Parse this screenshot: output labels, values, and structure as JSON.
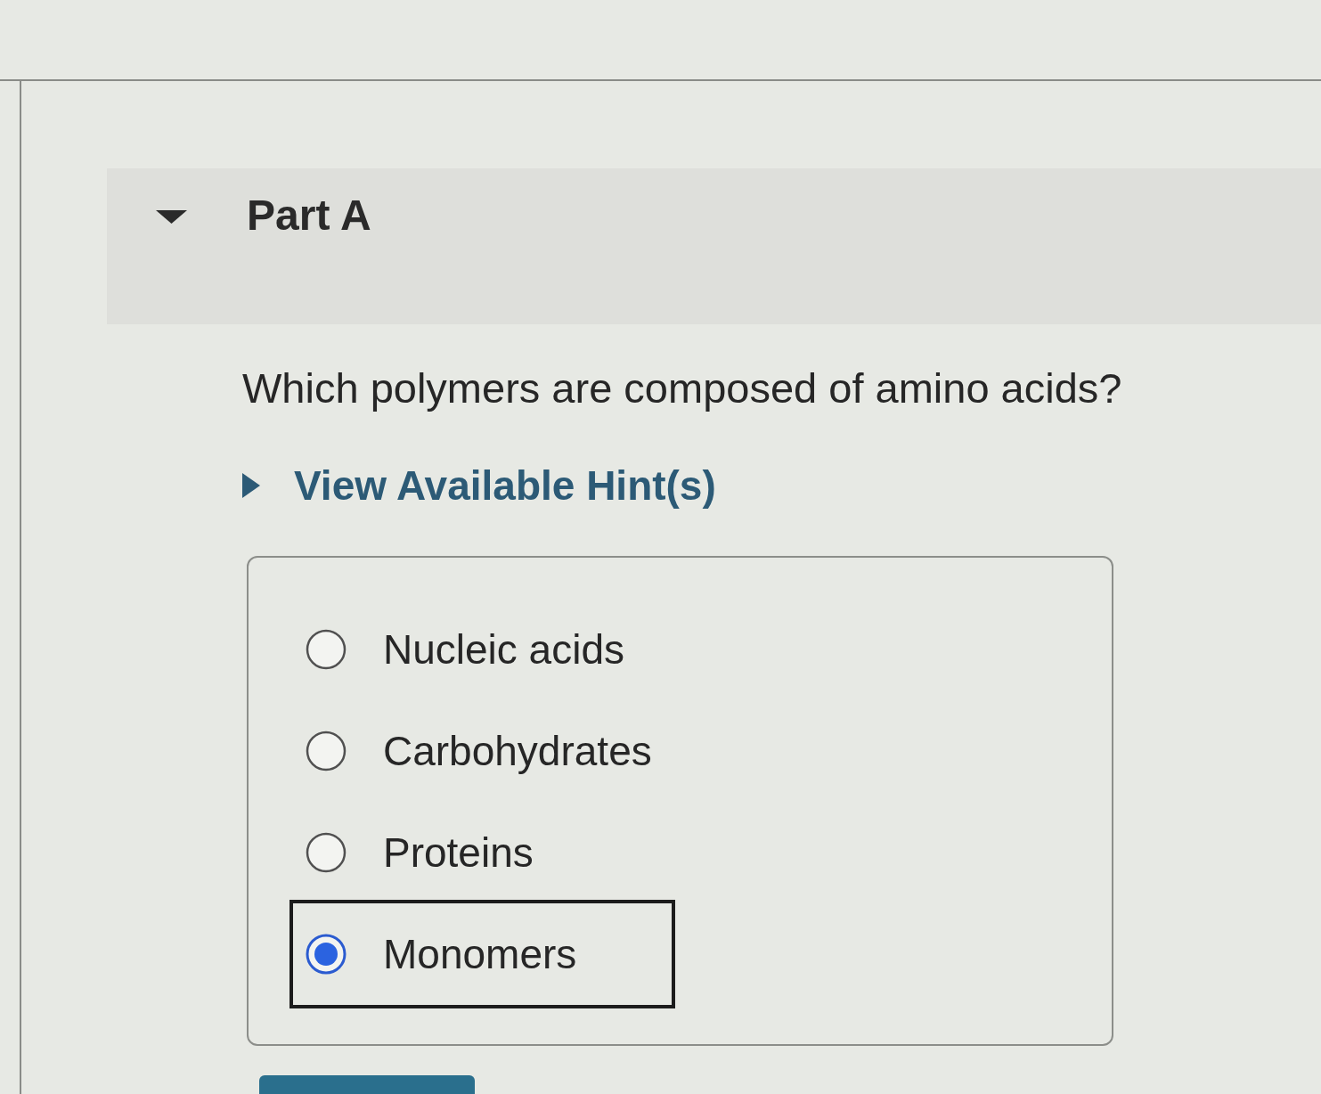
{
  "part": {
    "title": "Part A",
    "expanded": true
  },
  "question": "Which polymers are composed of amino acids?",
  "hint": {
    "label": "View Available Hint(s)",
    "expanded": false
  },
  "options": [
    {
      "label": "Nucleic acids",
      "selected": false,
      "focused": false
    },
    {
      "label": "Carbohydrates",
      "selected": false,
      "focused": false
    },
    {
      "label": "Proteins",
      "selected": false,
      "focused": false
    },
    {
      "label": "Monomers",
      "selected": true,
      "focused": true
    }
  ]
}
